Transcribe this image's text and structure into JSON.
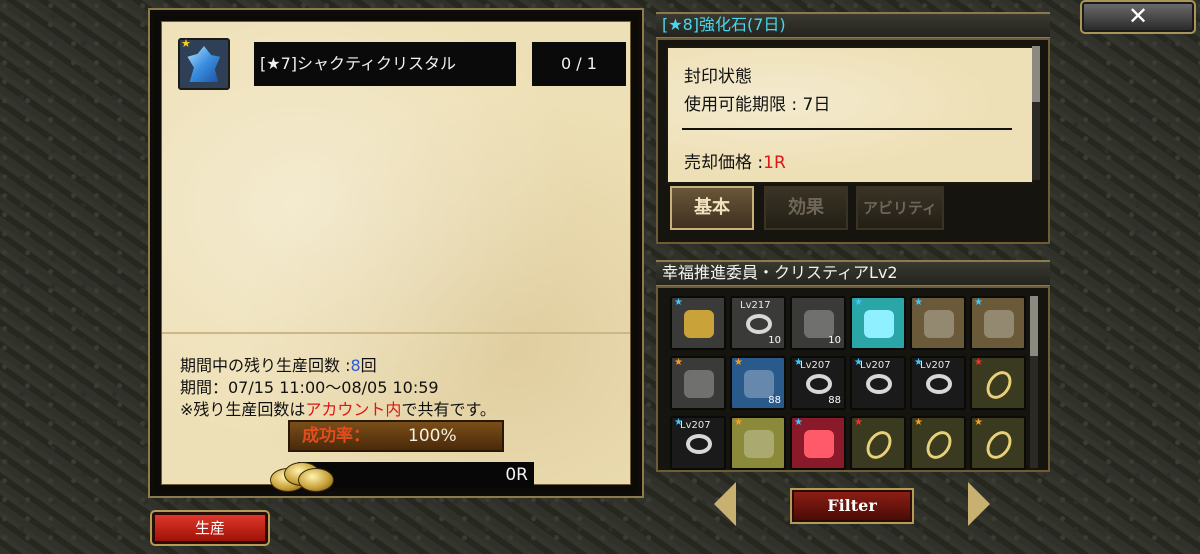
{
  "left_panel": {
    "item_star": "★",
    "item_name": "[★7]シャクティクリスタル",
    "item_count": "0 / 1",
    "remaining_label": "期間中の残り生産回数 :",
    "remaining_value": "8",
    "remaining_unit": "回",
    "period": "期間：07/15 11:00～08/05 10:59",
    "notice_prefix": "※残り生産回数は",
    "notice_highlight": "アカウント内",
    "notice_suffix": "で共有です。",
    "success_label": "成功率：",
    "success_value": "100%",
    "cost_value": "0R"
  },
  "produce_button": "生産",
  "close_button": "✕",
  "detail": {
    "title": "[★8]強化石(7日)",
    "seal_status": "封印状態",
    "expiry": "使用可能期限 : 7日",
    "price_label": "売却価格 :",
    "price_value": "1R",
    "tabs": [
      "基本",
      "効果",
      "アビリティ"
    ]
  },
  "inventory": {
    "title": "幸福推進委員・クリスティアLv2",
    "slots": [
      {
        "icon": "coin-pile-icon",
        "star": "★",
        "star_color": "#3ac8ff",
        "bg": "#3a3a38"
      },
      {
        "icon": "ring-icon",
        "star": "",
        "star_color": "",
        "lv": "Lv217",
        "num": "10",
        "bg": "#3a3a38"
      },
      {
        "icon": "wheel-icon",
        "star": "",
        "star_color": "",
        "num": "10",
        "bg": "#3a3a38"
      },
      {
        "icon": "crystal-shard-icon",
        "star": "★",
        "star_color": "#3ac8ff",
        "bg": "#2aa6a6"
      },
      {
        "icon": "treasure-chest-icon",
        "star": "★",
        "star_color": "#3ac8ff",
        "bg": "#6a5a3a"
      },
      {
        "icon": "treasure-chest-icon",
        "star": "★",
        "star_color": "#3ac8ff",
        "bg": "#6a5a3a"
      },
      {
        "icon": "magnifier-icon",
        "star": "★",
        "star_color": "#ff9a1a",
        "bg": "#3a3a38"
      },
      {
        "icon": "scroll-map-icon",
        "star": "★",
        "star_color": "#ff9a1a",
        "num": "88",
        "bg": "#2a5a8c"
      },
      {
        "icon": "ring-icon",
        "star": "★",
        "star_color": "#3ac8ff",
        "lv": "Lv207",
        "num": "88",
        "bg": "#1a1a1a"
      },
      {
        "icon": "ring-icon",
        "star": "★",
        "star_color": "#3ac8ff",
        "lv": "Lv207",
        "bg": "#1a1a1a"
      },
      {
        "icon": "ring-icon",
        "star": "★",
        "star_color": "#3ac8ff",
        "lv": "Lv207",
        "bg": "#1a1a1a"
      },
      {
        "icon": "gem-amulet-icon",
        "star": "★",
        "star_color": "#ff2a2a",
        "bg": "#3a3a20"
      },
      {
        "icon": "necklace-icon",
        "star": "★",
        "star_color": "#3ac8ff",
        "lv": "Lv207",
        "bg": "#1a1a1a"
      },
      {
        "icon": "figure-icon",
        "star": "★",
        "star_color": "#ff9a1a",
        "bg": "#8a8a3a"
      },
      {
        "icon": "heart-icon",
        "star": "★",
        "star_color": "#3ac8ff",
        "bg": "#8a1a2a"
      },
      {
        "icon": "gem-amulet-icon",
        "star": "★",
        "star_color": "#ff2a2a",
        "bg": "#3a3a20"
      },
      {
        "icon": "gem-amulet-icon",
        "star": "★",
        "star_color": "#ff9a1a",
        "bg": "#3a3a20"
      },
      {
        "icon": "gem-amulet-icon",
        "star": "★",
        "star_color": "#ff9a1a",
        "bg": "#3a3a20"
      }
    ]
  },
  "filter_button": "Filter",
  "colors": {
    "accent_cyan": "#49d7f0",
    "price_red": "#e01515",
    "count_blue": "#2b5bd8"
  }
}
